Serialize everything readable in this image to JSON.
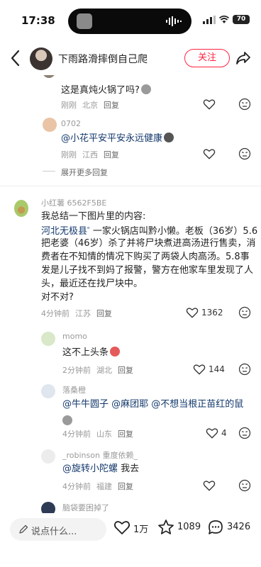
{
  "status_bar": {
    "time": "17:38",
    "battery": "70"
  },
  "header": {
    "username": "下雨路滑摔倒自己爬",
    "follow_label": "关注"
  },
  "comments": [
    {
      "text": "这是真炖火锅了吗?",
      "time": "刚刚",
      "location": "北京",
      "reply_label": "回复"
    },
    {
      "username": "0702",
      "mention": "@小花平安平安永远健康",
      "time": "刚刚",
      "location": "江西",
      "reply_label": "回复"
    },
    {
      "expand_label": "展开更多回复"
    },
    {
      "username": "小红薯 6562F5BE",
      "lines": [
        "我总结一下图片里的内容:",
        "一家火锅店叫黔小懒。老板（36岁）5.6",
        "把老婆（46岁）杀了并将尸块煮进高汤进行售卖，消",
        "费者在不知情的情况下购买了两袋人肉高汤。5.8事",
        "发是儿子找不到妈了报警，警方在他家车里发现了人",
        "头，最近还在找尸块中。",
        "对不对?"
      ],
      "link": "河北无极县",
      "time": "4分钟前",
      "location": "江苏",
      "reply_label": "回复",
      "likes": "1362"
    },
    {
      "username": "momo",
      "text": "这不上头条",
      "time": "2分钟前",
      "location": "湖北",
      "reply_label": "回复",
      "likes": "144"
    },
    {
      "username": "落桑橙",
      "mention": "@牛牛圆子 @麻团耶 @不想当根正苗红的鼠",
      "time": "4分钟前",
      "location": "山东",
      "reply_label": "回复",
      "likes": "4"
    },
    {
      "username": "_robinson 重度依赖_",
      "mention": "@旋转小陀螺",
      "text": "我去",
      "time": "4分钟前",
      "location": "福建",
      "reply_label": "回复"
    },
    {
      "username": "脑袋要困掉了"
    }
  ],
  "bottom_bar": {
    "input_placeholder": "说点什么...",
    "likes": "1万",
    "stars": "1089",
    "comments": "3426"
  },
  "colors": {
    "accent": "#ff2442",
    "mention": "#13386c",
    "meta": "#999999"
  }
}
